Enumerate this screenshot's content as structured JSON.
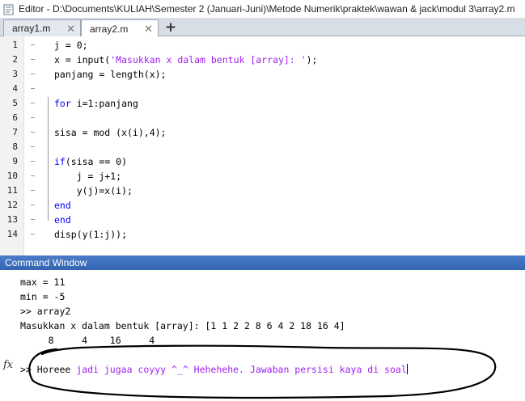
{
  "window": {
    "title": "Editor - D:\\Documents\\KULIAH\\Semester 2 (Januari-Juni)\\Metode Numerik\\praktek\\wawan & jack\\modul 3\\array2.m"
  },
  "tabs": [
    {
      "label": "array1.m",
      "active": false,
      "close": "✕"
    },
    {
      "label": "array2.m",
      "active": true,
      "close": "✕"
    }
  ],
  "add_tab": "+",
  "editor_lines": [
    {
      "n": "1",
      "segs": [
        {
          "t": "j = 0;",
          "c": "plain"
        }
      ]
    },
    {
      "n": "2",
      "segs": [
        {
          "t": "x = input(",
          "c": "plain"
        },
        {
          "t": "'Masukkan x dalam bentuk [array]: '",
          "c": "str"
        },
        {
          "t": ");",
          "c": "plain"
        }
      ]
    },
    {
      "n": "3",
      "segs": [
        {
          "t": "panjang = length(x);",
          "c": "plain"
        }
      ]
    },
    {
      "n": "4",
      "segs": []
    },
    {
      "n": "5",
      "segs": [
        {
          "t": "for",
          "c": "kw"
        },
        {
          "t": " i=1:panjang",
          "c": "plain"
        }
      ]
    },
    {
      "n": "6",
      "segs": []
    },
    {
      "n": "7",
      "segs": [
        {
          "t": "sisa = mod (x(i),4);",
          "c": "plain"
        }
      ]
    },
    {
      "n": "8",
      "segs": []
    },
    {
      "n": "9",
      "segs": [
        {
          "t": "if",
          "c": "kw"
        },
        {
          "t": "(sisa == 0)",
          "c": "plain"
        }
      ]
    },
    {
      "n": "10",
      "segs": [
        {
          "t": "    j = j+1;",
          "c": "plain"
        }
      ]
    },
    {
      "n": "11",
      "segs": [
        {
          "t": "    y(j)=x(i);",
          "c": "plain"
        }
      ]
    },
    {
      "n": "12",
      "segs": [
        {
          "t": "end",
          "c": "kw"
        }
      ]
    },
    {
      "n": "13",
      "segs": [
        {
          "t": "end",
          "c": "kw"
        }
      ]
    },
    {
      "n": "14",
      "segs": [
        {
          "t": "disp(y(1:j));",
          "c": "plain"
        }
      ]
    }
  ],
  "command_window": {
    "title": "Command Window",
    "output": [
      "max = 11",
      "min = -5",
      ">> array2",
      "Masukkan x dalam bentuk [array]: [1 1 2 2 8 6 4 2 18 16 4]",
      "     8     4    16     4"
    ],
    "prompt": ">>",
    "input_plain": "Horeee ",
    "input_string": "jadi jugaa coyyy ^_^ Hehehehe. Jawaban persisi kaya di soal",
    "fx_label": "fx"
  },
  "colors": {
    "keyword": "#0000ff",
    "string": "#a020f0",
    "cmd_header": "#3e70bd"
  }
}
